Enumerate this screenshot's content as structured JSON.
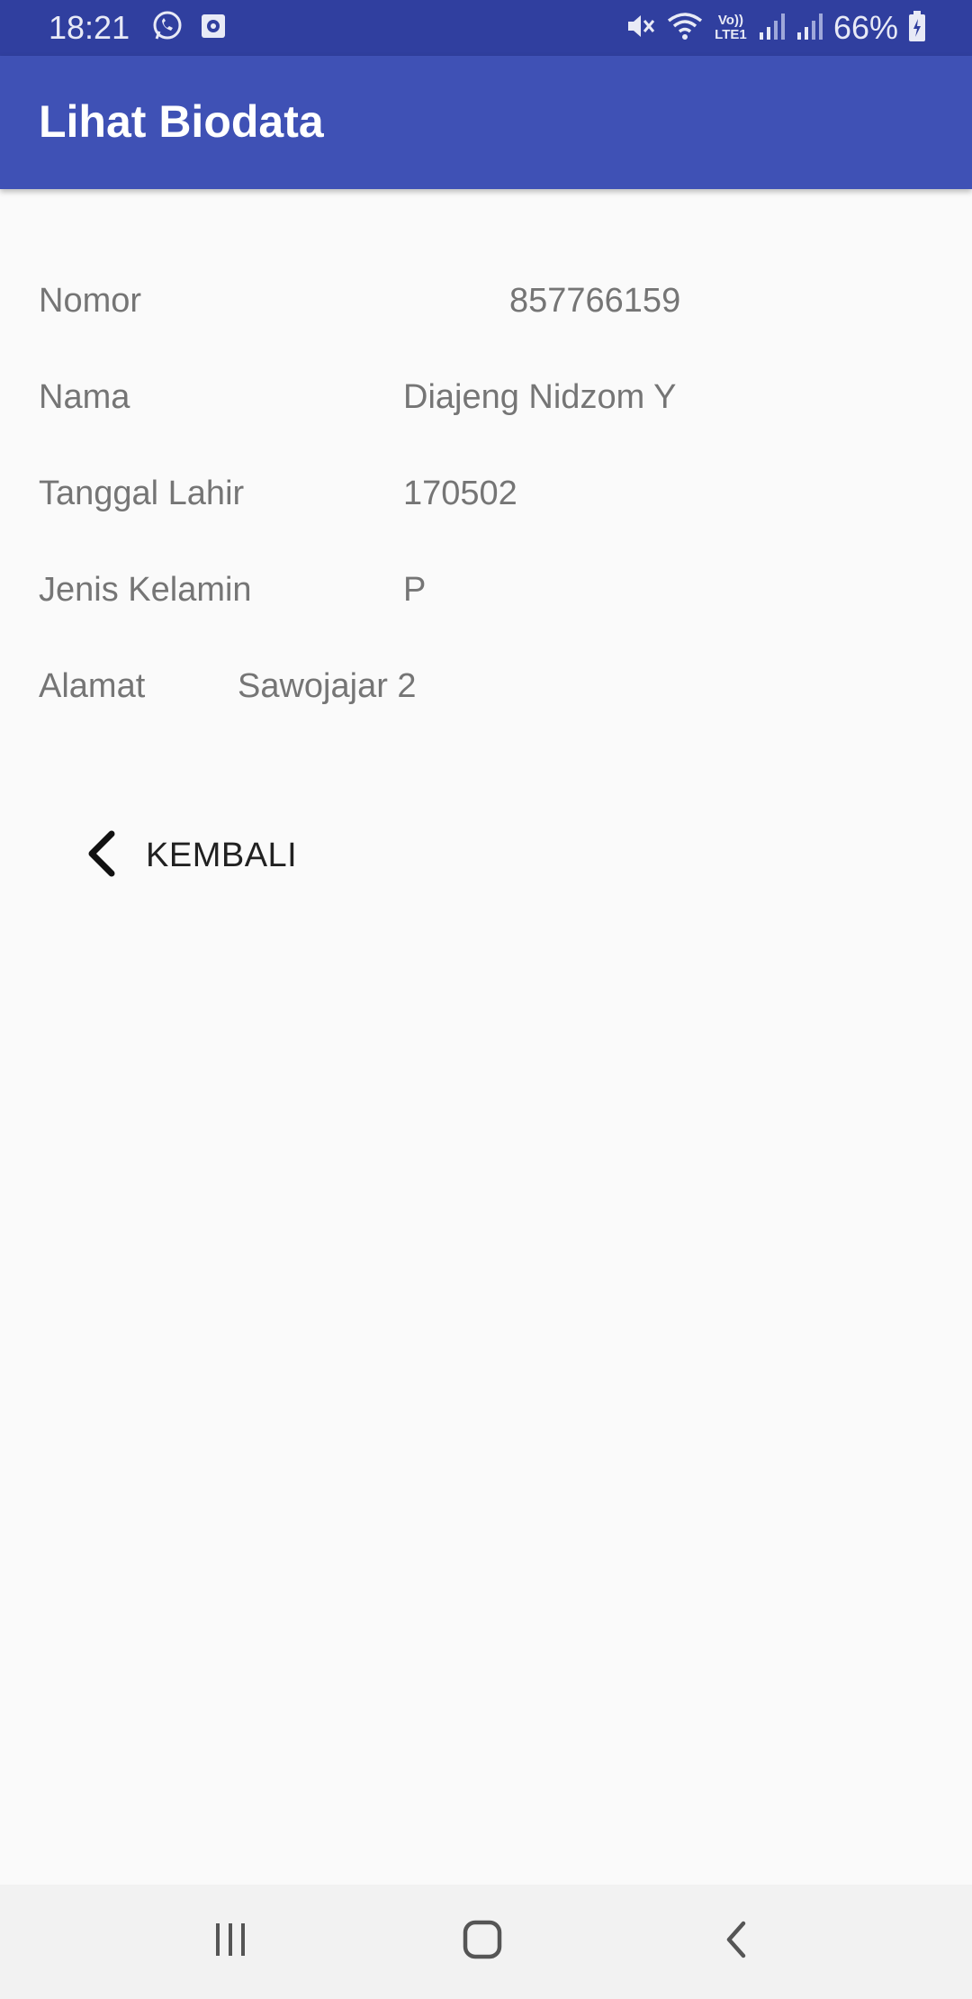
{
  "status_bar": {
    "time": "18:21",
    "battery": "66%",
    "left_icons": [
      "whatsapp-icon",
      "notification-app-icon"
    ],
    "right_icons": [
      "mute-icon",
      "wifi-icon",
      "volte-icon",
      "signal-icon",
      "signal-icon",
      "battery-charging-icon"
    ],
    "network_label": "Vo)) LTE1"
  },
  "app_bar": {
    "title": "Lihat Biodata",
    "color": "#3f51b5",
    "status_color": "#303f9f"
  },
  "biodata": {
    "nomor": {
      "label": "Nomor",
      "value": "857766159"
    },
    "nama": {
      "label": "Nama",
      "value": "Diajeng Nidzom Y"
    },
    "tanggal_lahir": {
      "label": "Tanggal Lahir",
      "value": "170502"
    },
    "jenis_kelamin": {
      "label": "Jenis Kelamin",
      "value": "P"
    },
    "alamat": {
      "label": "Alamat",
      "value": "Sawojajar 2"
    }
  },
  "back_button": {
    "label": "KEMBALI",
    "icon": "chevron-left-icon"
  },
  "nav_bar": {
    "buttons": [
      "recent-apps-icon",
      "home-icon",
      "back-icon"
    ]
  }
}
